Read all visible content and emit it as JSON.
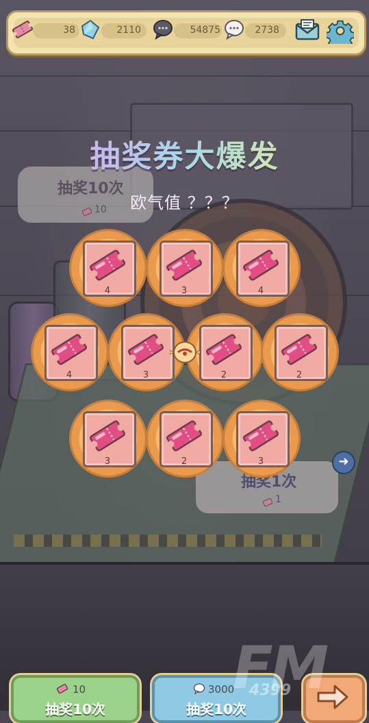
{
  "currencies": [
    {
      "name": "ticket",
      "icon": "ticket-icon",
      "value": "38"
    },
    {
      "name": "crystal",
      "icon": "crystal-icon",
      "value": "2110"
    },
    {
      "name": "dark-bubble",
      "icon": "speech-bubble-dark-icon",
      "value": "54875"
    },
    {
      "name": "light-bubble",
      "icon": "speech-bubble-light-icon",
      "value": "2738"
    }
  ],
  "title": "抽奖券大爆发",
  "luck_text": "欧气值 ？？？",
  "background_buttons": {
    "draw10": {
      "label": "抽奖10次",
      "cost": "10"
    },
    "draw1": {
      "label": "抽奖1次",
      "cost": "1"
    }
  },
  "tickets": [
    {
      "count": "4"
    },
    {
      "count": "3"
    },
    {
      "count": "4"
    },
    {
      "count": "4"
    },
    {
      "count": "3"
    },
    {
      "count": "2"
    },
    {
      "count": "2"
    },
    {
      "count": "3"
    },
    {
      "count": "2"
    },
    {
      "count": "3"
    }
  ],
  "bottom_buttons": {
    "ticket_draw": {
      "cost": "10",
      "label": "抽奖10次"
    },
    "bubble_draw": {
      "cost": "3000",
      "label": "抽奖10次"
    }
  },
  "watermark": {
    "main": "FM",
    "sub": "4399"
  },
  "colors": {
    "accent_green": "#9bd28b",
    "accent_blue": "#8fc9e3",
    "ticket_pink": "#f0a9a3",
    "frame_orange": "#f7b86b"
  }
}
